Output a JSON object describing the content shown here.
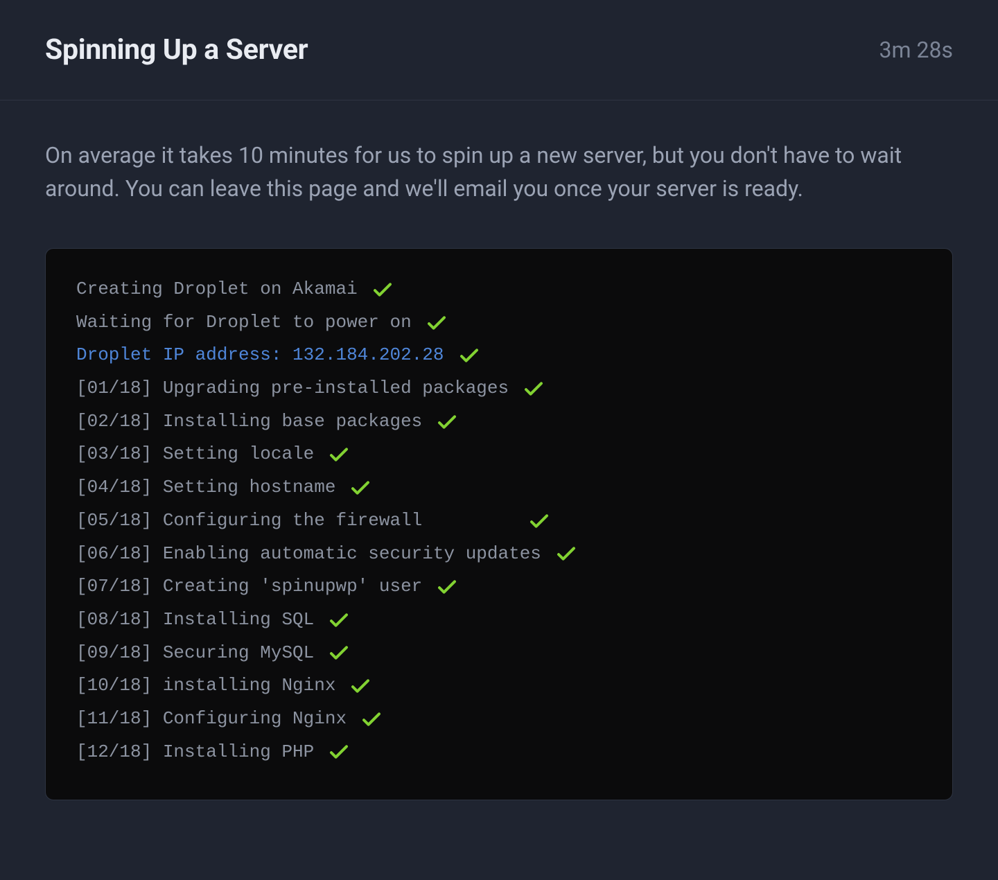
{
  "header": {
    "title": "Spinning Up a Server",
    "elapsed": "3m 28s"
  },
  "description": "On average it takes 10 minutes for us to spin up a new server, but you don't have to wait around. You can leave this page and we'll email you once your server is ready.",
  "colors": {
    "accent_green": "#82d232",
    "link_blue": "#4f86d9",
    "terminal_bg": "#0b0b0c",
    "page_bg": "#1f2430"
  },
  "terminal": {
    "lines": [
      {
        "text": "Creating Droplet on Akamai",
        "done": true,
        "highlight": false
      },
      {
        "text": "Waiting for Droplet to power on",
        "done": true,
        "highlight": false
      },
      {
        "text": "Droplet IP address: 132.184.202.28",
        "done": true,
        "highlight": true
      },
      {
        "text": "[01/18] Upgrading pre-installed packages",
        "done": true,
        "highlight": false
      },
      {
        "text": "[02/18] Installing base packages",
        "done": true,
        "highlight": false
      },
      {
        "text": "[03/18] Setting locale",
        "done": true,
        "highlight": false
      },
      {
        "text": "[04/18] Setting hostname",
        "done": true,
        "highlight": false
      },
      {
        "text": "[05/18] Configuring the firewall",
        "done": true,
        "highlight": false,
        "wide_gap": true
      },
      {
        "text": "[06/18] Enabling automatic security updates",
        "done": true,
        "highlight": false
      },
      {
        "text": "[07/18] Creating 'spinupwp' user",
        "done": true,
        "highlight": false
      },
      {
        "text": "[08/18] Installing SQL",
        "done": true,
        "highlight": false
      },
      {
        "text": "[09/18] Securing MySQL",
        "done": true,
        "highlight": false
      },
      {
        "text": "[10/18] installing Nginx",
        "done": true,
        "highlight": false
      },
      {
        "text": "[11/18] Configuring Nginx",
        "done": true,
        "highlight": false
      },
      {
        "text": "[12/18] Installing PHP",
        "done": true,
        "highlight": false
      }
    ]
  }
}
